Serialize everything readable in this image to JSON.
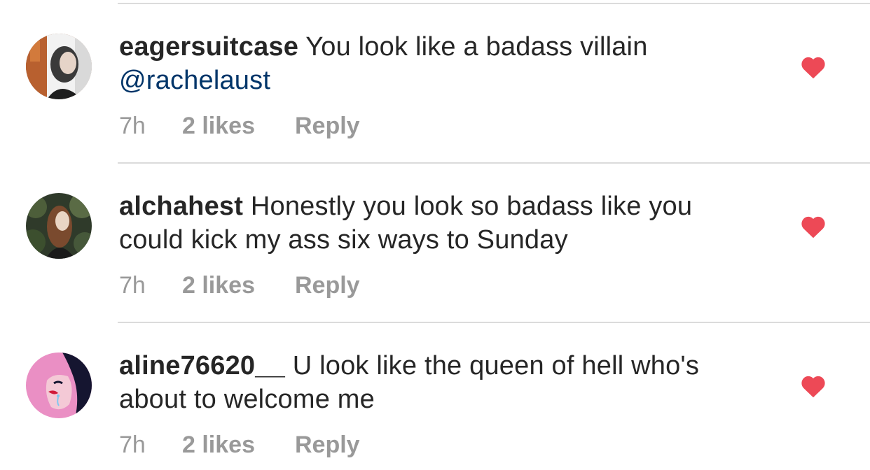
{
  "comments": [
    {
      "username": "eagersuitcase",
      "text": "You look like a badass villain",
      "mention": "@rachelaust",
      "time": "7h",
      "likes": "2 likes",
      "reply": "Reply",
      "liked": true
    },
    {
      "username": "alchahest",
      "text": "Honestly you look so badass like you could kick my ass six ways to Sunday",
      "mention": "",
      "time": "7h",
      "likes": "2 likes",
      "reply": "Reply",
      "liked": true
    },
    {
      "username": "aline76620__",
      "text": "U look like the queen of hell who's about to welcome me",
      "mention": "",
      "time": "7h",
      "likes": "2 likes",
      "reply": "Reply",
      "liked": true
    }
  ],
  "colors": {
    "heart": "#ed4956",
    "mention": "#003569",
    "meta": "#999999",
    "text": "#262626",
    "divider": "#dbdbdb"
  }
}
